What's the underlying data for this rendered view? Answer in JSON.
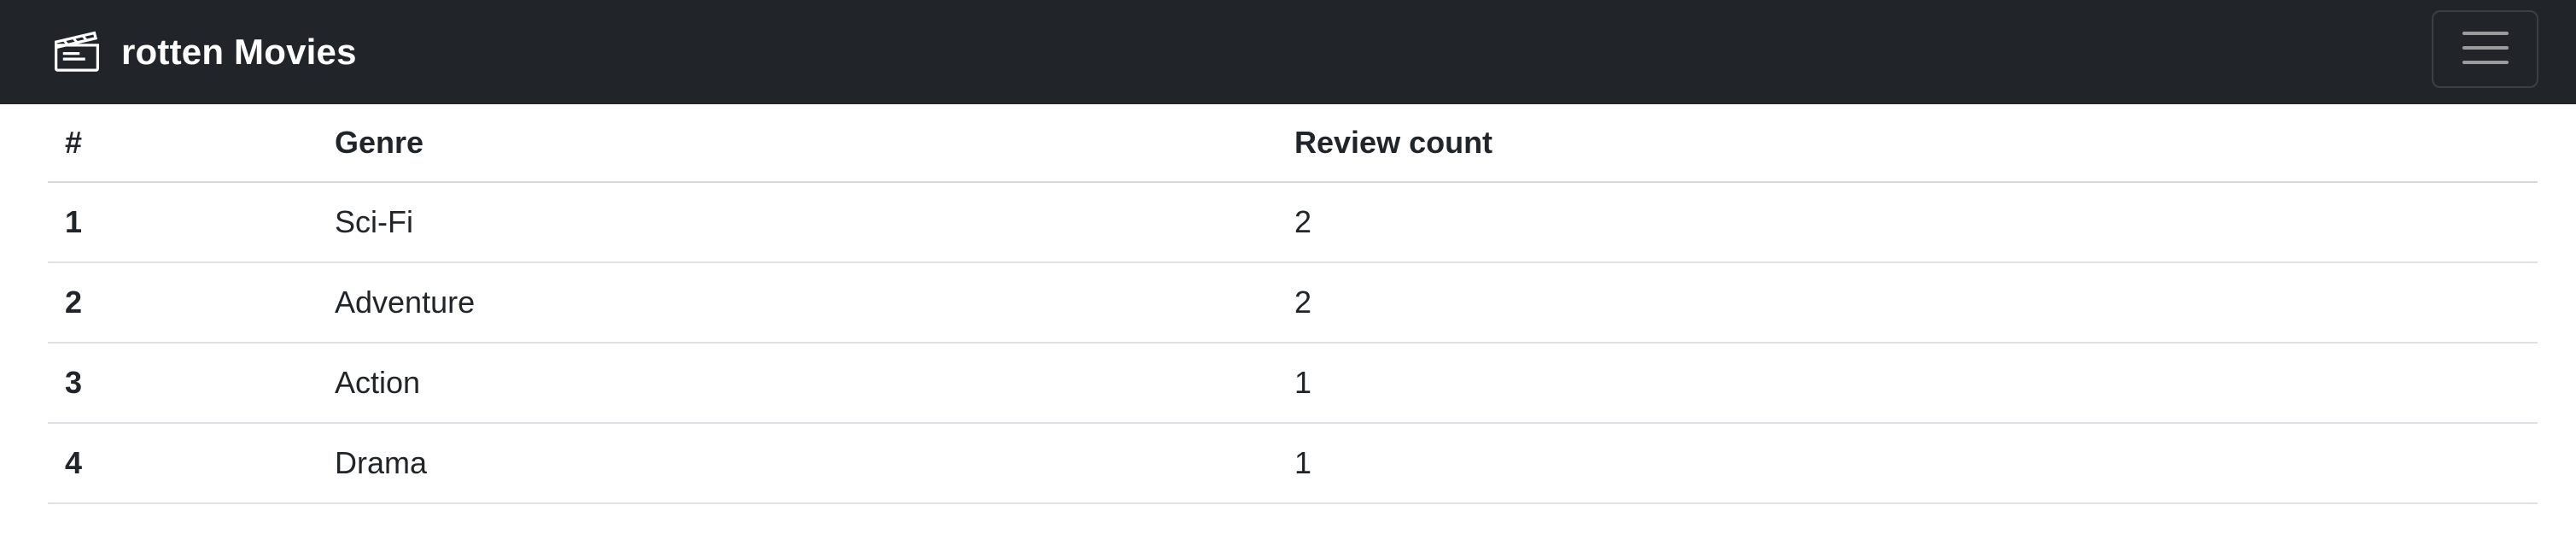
{
  "navbar": {
    "brand_text": "rotten Movies",
    "brand_icon": "film-icon",
    "toggler_icon": "hamburger-menu-icon",
    "background": "#212529"
  },
  "table": {
    "headers": [
      "#",
      "Genre",
      "Review count"
    ],
    "rows": [
      {
        "num": "1",
        "genre": "Sci-Fi",
        "count": "2"
      },
      {
        "num": "2",
        "genre": "Adventure",
        "count": "2"
      },
      {
        "num": "3",
        "genre": "Action",
        "count": "1"
      },
      {
        "num": "4",
        "genre": "Drama",
        "count": "1"
      }
    ]
  }
}
